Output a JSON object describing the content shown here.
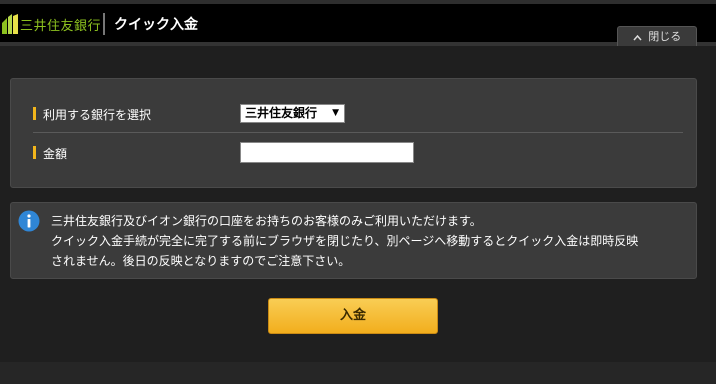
{
  "header": {
    "logo_text": "三井住友銀行",
    "title": "クイック入金",
    "close_label": "閉じる"
  },
  "form": {
    "bank_label": "利用する銀行を選択",
    "bank_selected": "三井住友銀行",
    "amount_label": "金額",
    "amount_value": ""
  },
  "info": {
    "icon": "info-icon",
    "lines": [
      "三井住友銀行及びイオン銀行の口座をお持ちのお客様のみご利用いただけます。",
      "クイック入金手続が完全に完了する前にブラウザを閉じたり、別ページへ移動するとクイック入金は即時反映",
      "されません。後日の反映となりますのでご注意下さい。"
    ]
  },
  "submit_label": "入金",
  "colors": {
    "brand_green": "#8dc21f",
    "accent_yellow": "#f2b51b",
    "info_blue": "#2f86d6"
  }
}
